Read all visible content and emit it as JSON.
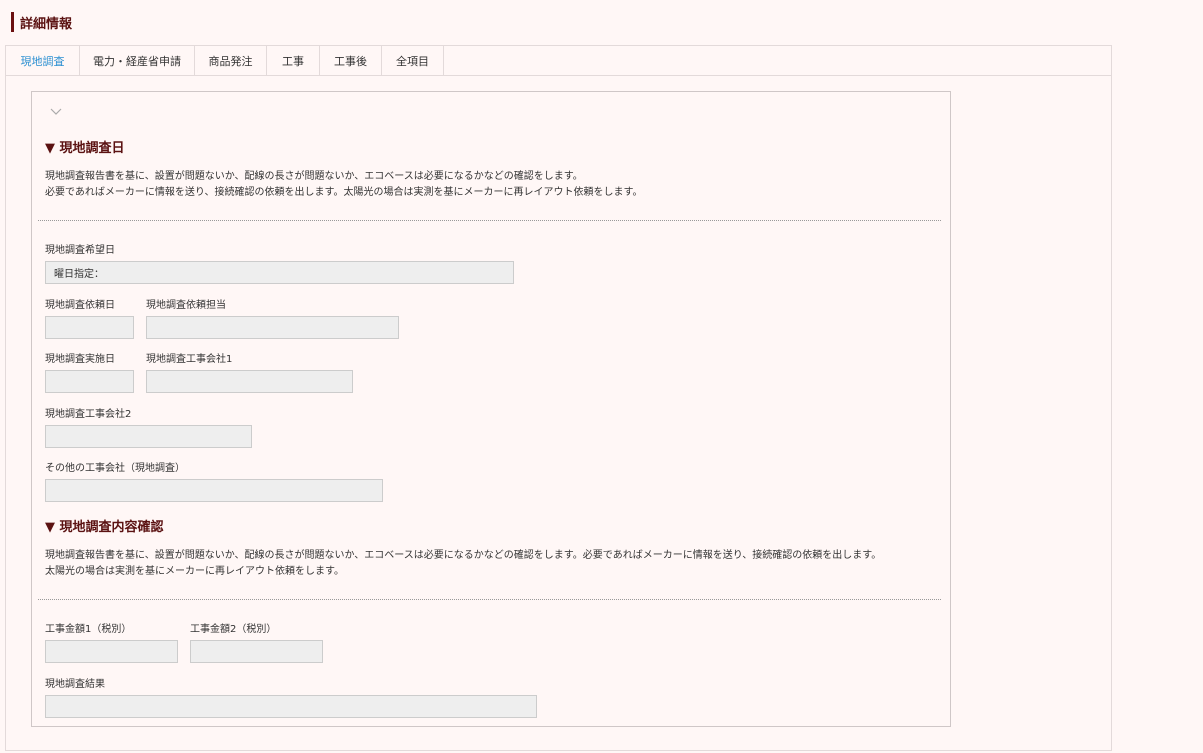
{
  "page": {
    "title": "詳細情報"
  },
  "tabs": [
    {
      "label": "現地調査",
      "active": true
    },
    {
      "label": "電力・経産省申請",
      "active": false
    },
    {
      "label": "商品発注",
      "active": false
    },
    {
      "label": "工事",
      "active": false
    },
    {
      "label": "工事後",
      "active": false
    },
    {
      "label": "全項目",
      "active": false
    }
  ],
  "section1": {
    "title": "▼ 現地調査日",
    "desc_line1": "現地調査報告書を基に、設置が問題ないか、配線の長さが問題ないか、エコベースは必要になるかなどの確認をします。",
    "desc_line2": "必要であればメーカーに情報を送り、接続確認の依頼を出します。太陽光の場合は実測を基にメーカーに再レイアウト依頼をします。",
    "fields": {
      "desired_date_label": "現地調査希望日",
      "desired_date_value": "曜日指定：",
      "request_date_label": "現地調査依頼日",
      "request_person_label": "現地調査依頼担当",
      "impl_date_label": "現地調査実施日",
      "company1_label": "現地調査工事会社1",
      "company2_label": "現地調査工事会社2",
      "other_company_label": "その他の工事会社（現地調査）"
    }
  },
  "section2": {
    "title": "▼ 現地調査内容確認",
    "desc_line1": "現地調査報告書を基に、設置が問題ないか、配線の長さが問題ないか、エコベースは必要になるかなどの確認をします。必要であればメーカーに情報を送り、接続確認の依頼を出します。",
    "desc_line2": "太陽光の場合は実測を基にメーカーに再レイアウト依頼をします。",
    "fields": {
      "amount1_label": "工事金額1（税別）",
      "amount2_label": "工事金額2（税別）",
      "result_label": "現地調査結果"
    }
  },
  "colors": {
    "accent": "#6b0f10",
    "active_tab": "#2b8fd1",
    "background": "#fff7f6",
    "field_bg": "#eeeeee"
  }
}
